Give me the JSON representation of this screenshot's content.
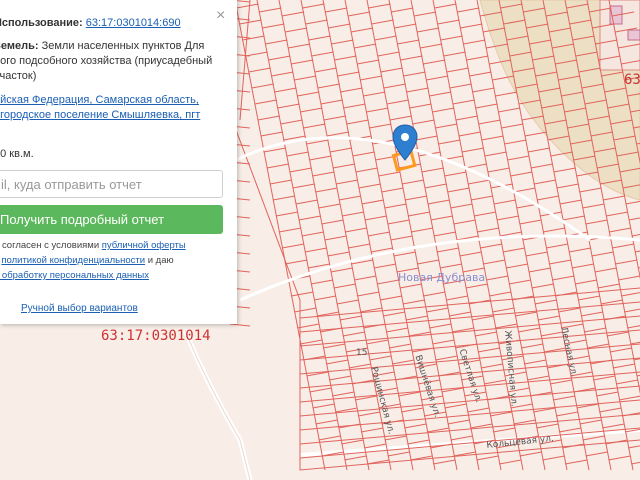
{
  "map": {
    "cadastral_block": "63:17:0301014",
    "cadastral_block_partial": "63",
    "place_name": "Новая Дубрава",
    "house_number": "15",
    "streets": [
      "Рощинская ул.",
      "Вишнёвая ул.",
      "Светлая ул.",
      "Лесная ул.",
      "Живописная ул.",
      "Кольцевая ул."
    ]
  },
  "panel": {
    "close_icon": "×",
    "usage_label": "Использование:",
    "usage_value": "63:17:0301014:690",
    "category_label": "Земель:",
    "category_value": "Земли населенных пунктов Для",
    "category_line2": "ного подсобного хозяйства (приусадебный",
    "category_line3": "участок)",
    "address_line1": "ийская Федерация, Самарская область,",
    "address_line2": ", городское поселение Смышляевка, пгт",
    "address_line3": "",
    "area": "00 кв.м.",
    "email_placeholder": "il, куда отправить отчет",
    "report_button": "Получить подробный отчет",
    "legal_line1_prefix": "и согласен с условиями ",
    "legal_line1_link": "публичной оферты",
    "legal_line2_prefix": "с ",
    "legal_line2_link": "политикой конфиденциальности",
    "legal_line2_suffix": " и даю",
    "legal_line3_link": "а обработку персональных данных",
    "manual_link": "Ручной выбор вариантов"
  },
  "colors": {
    "parcel_line": "#e0645c",
    "button": "#5cb85c",
    "link": "#1a5fb4",
    "river": "#ecdcbc",
    "pin": "#2f7fd0"
  }
}
